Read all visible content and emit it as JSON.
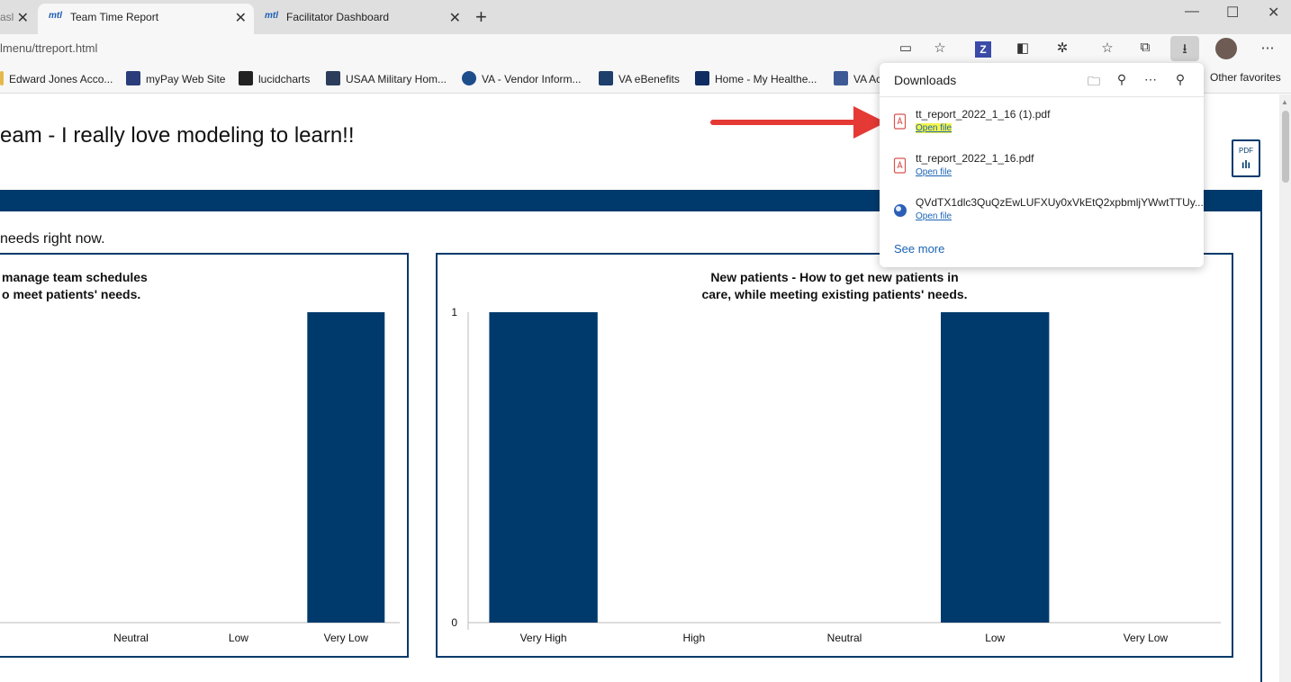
{
  "browser": {
    "tabs": [
      {
        "label": "asl",
        "active": false
      },
      {
        "label": "Team Time Report",
        "active": true,
        "icon": "mtl"
      },
      {
        "label": "Facilitator Dashboard",
        "active": false,
        "icon": "mtl"
      }
    ],
    "url": "lmenu/ttreport.html",
    "bookmarks": [
      {
        "label": "Edward Jones Acco...",
        "icon_color": "#e5b84a"
      },
      {
        "label": "myPay Web Site",
        "icon_color": "#2a3c7a"
      },
      {
        "label": "lucidcharts",
        "icon_color": "#222222"
      },
      {
        "label": "USAA Military Hom...",
        "icon_color": "#2b3d5b"
      },
      {
        "label": "VA - Vendor Inform...",
        "icon_color": "#1e4d8c"
      },
      {
        "label": "VA eBenefits",
        "icon_color": "#1e3e6c"
      },
      {
        "label": "Home - My Healthe...",
        "icon_color": "#0f2d63"
      },
      {
        "label": "VA Ac",
        "icon_color": "#3d5a94"
      }
    ],
    "other_favorites": "Other favorites",
    "toolbar_z": "Z"
  },
  "page": {
    "title": "eam - I really love modeling to learn!!",
    "section_text": "needs right now.",
    "pdf_label": "PDF"
  },
  "downloads": {
    "title": "Downloads",
    "items": [
      {
        "name": "tt_report_2022_1_16 (1).pdf",
        "action": "Open file",
        "type": "pdf",
        "highlight": true
      },
      {
        "name": "tt_report_2022_1_16.pdf",
        "action": "Open file",
        "type": "pdf",
        "highlight": false
      },
      {
        "name": "QVdTX1dlc3QuQzEwLUFXUy0xVkEtQ2xpbmljYWwtTTUy...",
        "action": "Open file",
        "type": "web",
        "highlight": false
      }
    ],
    "see_more": "See more"
  },
  "chart_data": [
    {
      "type": "bar",
      "title": "manage team schedules\no meet patients' needs.",
      "categories": [
        "Neutral",
        "Low",
        "Very Low"
      ],
      "values": [
        0,
        0,
        1
      ],
      "ylim": [
        0,
        1
      ],
      "color": "#003a6c"
    },
    {
      "type": "bar",
      "title": "New patients - How to get new patients in\ncare, while meeting existing patients' needs.",
      "categories": [
        "Very High",
        "High",
        "Neutral",
        "Low",
        "Very Low"
      ],
      "values": [
        1,
        0,
        0,
        1,
        0
      ],
      "ylim": [
        0,
        1
      ],
      "ytick_labels": [
        "0",
        "1"
      ],
      "color": "#003a6c"
    }
  ],
  "colors": {
    "accent": "#003a6c",
    "arrow": "#e53935",
    "link": "#1a63b5"
  }
}
